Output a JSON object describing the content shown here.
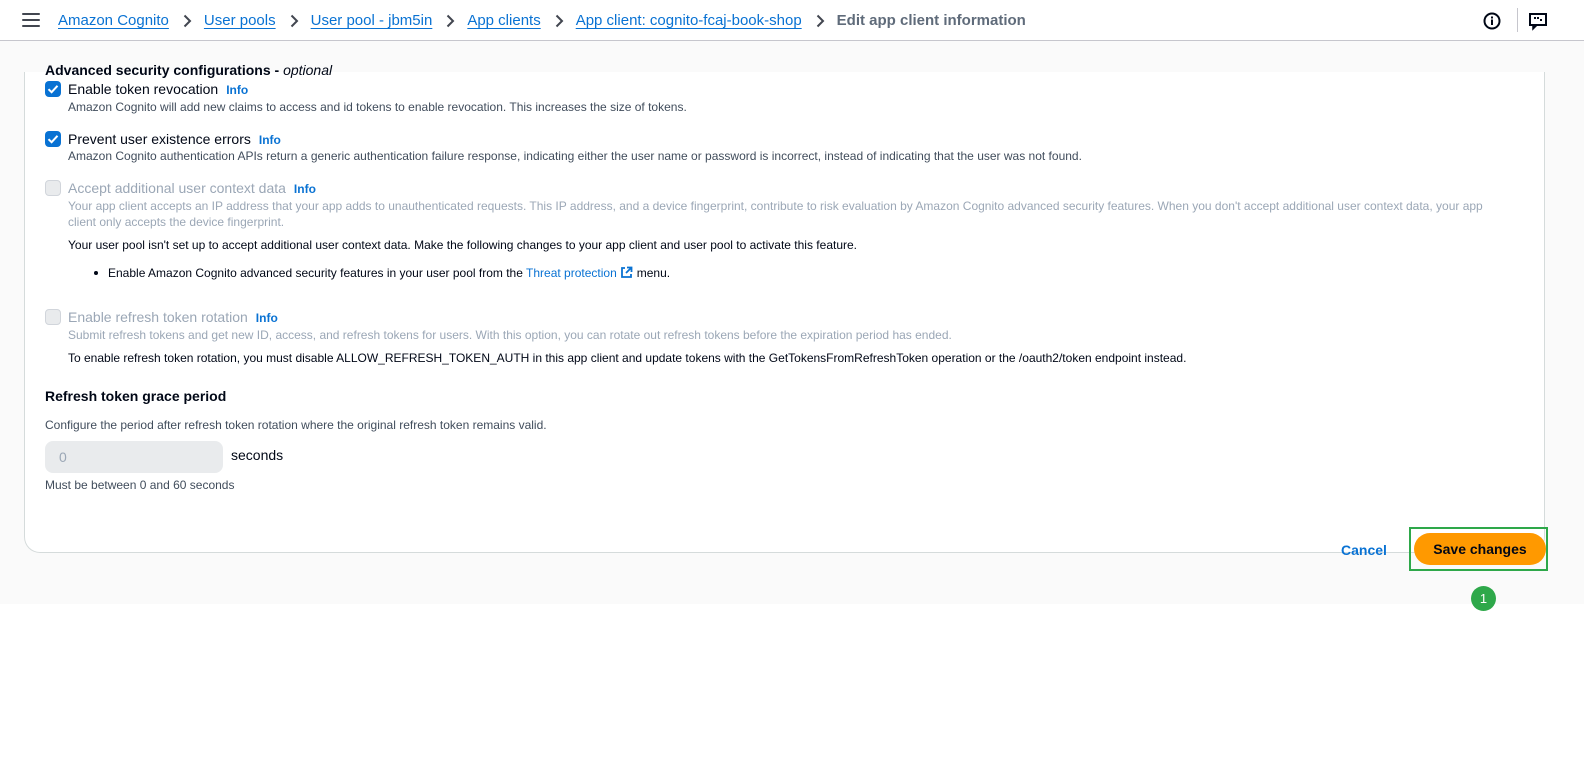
{
  "breadcrumb": {
    "items": [
      "Amazon Cognito",
      "User pools",
      "User pool - jbm5in",
      "App clients",
      "App client: cognito-fcaj-book-shop"
    ],
    "current": "Edit app client information"
  },
  "security": {
    "title": "Advanced security configurations",
    "optional": "optional",
    "separator": " - ",
    "info_label": "Info",
    "token_revocation": {
      "label": "Enable token revocation",
      "checked": true,
      "description": "Amazon Cognito will add new claims to access and id tokens to enable revocation. This increases the size of tokens."
    },
    "prevent_errors": {
      "label": "Prevent user existence errors",
      "checked": true,
      "description": "Amazon Cognito authentication APIs return a generic authentication failure response, indicating either the user name or password is incorrect, instead of indicating that the user was not found."
    },
    "context_data": {
      "label": "Accept additional user context data",
      "checked": false,
      "disabled": true,
      "description_line1": "Your app client accepts an IP address that your app adds to unauthenticated requests. This IP address, and a device fingerprint, contribute to risk evaluation by Amazon Cognito advanced security features. When you don't accept additional user context data, your app",
      "description_line2": "client only accepts the device fingerprint.",
      "note": "Your user pool isn't set up to accept additional user context data. Make the following changes to your app client and user pool to activate this feature.",
      "bullet_prefix": "Enable Amazon Cognito advanced security features in your user pool from the",
      "bullet_link": "Threat protection",
      "bullet_suffix": "menu."
    },
    "refresh_rotation": {
      "label": "Enable refresh token rotation",
      "checked": false,
      "disabled": true,
      "description": "Submit refresh tokens and get new ID, access, and refresh tokens for users. With this option, you can rotate out refresh tokens before the expiration period has ended.",
      "note": "To enable refresh token rotation, you must disable ALLOW_REFRESH_TOKEN_AUTH in this app client and update tokens with the GetTokensFromRefreshToken operation or the /oauth2/token endpoint instead."
    }
  },
  "grace_period": {
    "title": "Refresh token grace period",
    "description": "Configure the period after refresh token rotation where the original refresh token remains valid.",
    "value": "0",
    "unit": "seconds",
    "constraint": "Must be between 0 and 60 seconds"
  },
  "actions": {
    "cancel": "Cancel",
    "save": "Save changes"
  },
  "annotation": {
    "marker": "1",
    "color": "#2ea84a"
  },
  "colors": {
    "link": "#0972d3",
    "primary_button": "#ff9900",
    "checkbox": "#0972d3"
  }
}
